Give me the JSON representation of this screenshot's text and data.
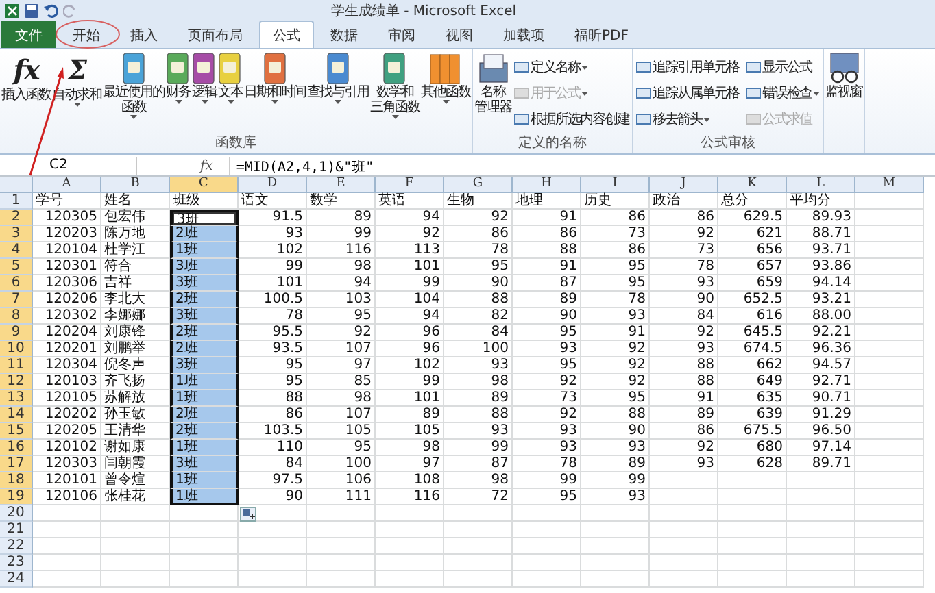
{
  "window": {
    "title": "学生成绩单 - Microsoft Excel"
  },
  "tabs": [
    {
      "label": "文件",
      "kind": "file",
      "selected": false
    },
    {
      "label": "开始",
      "kind": "tab",
      "selected": false
    },
    {
      "label": "插入",
      "kind": "tab",
      "selected": false
    },
    {
      "label": "页面布局",
      "kind": "tab",
      "selected": false
    },
    {
      "label": "公式",
      "kind": "tab",
      "selected": true
    },
    {
      "label": "数据",
      "kind": "tab",
      "selected": false
    },
    {
      "label": "审阅",
      "kind": "tab",
      "selected": false
    },
    {
      "label": "视图",
      "kind": "tab",
      "selected": false
    },
    {
      "label": "加载项",
      "kind": "tab",
      "selected": false
    },
    {
      "label": "福昕PDF",
      "kind": "tab",
      "selected": false
    }
  ],
  "ribbon": {
    "groups": [
      {
        "label": "函数库",
        "large_buttons": [
          {
            "kind": "glyph",
            "glyph": "fx",
            "lines": [
              "插入函数"
            ],
            "menu": false
          },
          {
            "kind": "glyph",
            "glyph": "Σ",
            "lines": [
              "自动求和"
            ],
            "menu": true
          },
          {
            "kind": "book",
            "color": "#4aa3d8",
            "lines": [
              "最近使用的",
              "函数"
            ],
            "menu": true
          },
          {
            "kind": "book",
            "color": "#5aaa5a",
            "lines": [
              "财务"
            ],
            "menu": true
          },
          {
            "kind": "book",
            "color": "#a64ca6",
            "lines": [
              "逻辑"
            ],
            "menu": true
          },
          {
            "kind": "book",
            "color": "#e8d040",
            "lines": [
              "文本"
            ],
            "menu": true
          },
          {
            "kind": "book",
            "color": "#e07040",
            "lines": [
              "日期和时间"
            ],
            "menu": true
          },
          {
            "kind": "book",
            "color": "#4a8ad0",
            "lines": [
              "查找与引用"
            ],
            "menu": true
          },
          {
            "kind": "book",
            "color": "#40a080",
            "lines": [
              "数学和",
              "三角函数"
            ],
            "menu": true
          },
          {
            "kind": "books",
            "color": "#f09030",
            "lines": [
              "其他函数"
            ],
            "menu": true
          }
        ]
      },
      {
        "label": "定义的名称",
        "large_buttons": [
          {
            "kind": "manager",
            "color": "#6a8ab0",
            "lines": [
              "名称",
              "管理器"
            ],
            "menu": false
          }
        ],
        "small_buttons": [
          {
            "label": "定义名称",
            "disabled": false,
            "menu": true
          },
          {
            "label": "用于公式",
            "disabled": true,
            "menu": true
          },
          {
            "label": "根据所选内容创建",
            "disabled": false,
            "menu": false
          }
        ]
      },
      {
        "label": "公式审核",
        "small_buttons": [
          {
            "label": "追踪引用单元格",
            "disabled": false,
            "menu": false
          },
          {
            "label": "显示公式",
            "disabled": false,
            "menu": false
          },
          {
            "label": "追踪从属单元格",
            "disabled": false,
            "menu": false
          },
          {
            "label": "错误检查",
            "disabled": false,
            "menu": true
          },
          {
            "label": "移去箭头",
            "disabled": false,
            "menu": true
          },
          {
            "label": "公式求值",
            "disabled": true,
            "menu": false
          }
        ]
      },
      {
        "large_buttons": [
          {
            "kind": "watch",
            "color": "#7090c0",
            "lines": [
              "监视窗"
            ],
            "menu": false
          }
        ]
      }
    ]
  },
  "formula_bar": {
    "name_box": "C2",
    "fx": "fx",
    "formula": "=MID(A2,4,1)&\"班\""
  },
  "sheet": {
    "columns": [
      {
        "letter": "A",
        "kind": "number",
        "selected": false
      },
      {
        "letter": "B",
        "kind": "text",
        "selected": false
      },
      {
        "letter": "C",
        "kind": "text",
        "selected": true
      },
      {
        "letter": "D",
        "kind": "number",
        "selected": false
      },
      {
        "letter": "E",
        "kind": "number",
        "selected": false
      },
      {
        "letter": "F",
        "kind": "number",
        "selected": false
      },
      {
        "letter": "G",
        "kind": "number",
        "selected": false
      },
      {
        "letter": "H",
        "kind": "number",
        "selected": false
      },
      {
        "letter": "I",
        "kind": "number",
        "selected": false
      },
      {
        "letter": "J",
        "kind": "number",
        "selected": false
      },
      {
        "letter": "K",
        "kind": "number",
        "selected": false
      },
      {
        "letter": "L",
        "kind": "number",
        "selected": false
      },
      {
        "letter": "M",
        "kind": "number",
        "selected": false
      }
    ],
    "rows": [
      {
        "number": "1",
        "kind": "header",
        "selected": false,
        "active": false,
        "cells": [
          "学号",
          "姓名",
          "班级",
          "语文",
          "数学",
          "英语",
          "生物",
          "地理",
          "历史",
          "政治",
          "总分",
          "平均分"
        ]
      },
      {
        "number": "2",
        "kind": "data",
        "selected": true,
        "active": true,
        "cells": [
          "120305",
          "包宏伟",
          "3班",
          "91.5",
          "89",
          "94",
          "92",
          "91",
          "86",
          "86",
          "629.5",
          "89.93"
        ]
      },
      {
        "number": "3",
        "kind": "data",
        "selected": true,
        "active": false,
        "cells": [
          "120203",
          "陈万地",
          "2班",
          "93",
          "99",
          "92",
          "86",
          "86",
          "73",
          "92",
          "621",
          "88.71"
        ]
      },
      {
        "number": "4",
        "kind": "data",
        "selected": true,
        "active": false,
        "cells": [
          "120104",
          "杜学江",
          "1班",
          "102",
          "116",
          "113",
          "78",
          "88",
          "86",
          "73",
          "656",
          "93.71"
        ]
      },
      {
        "number": "5",
        "kind": "data",
        "selected": true,
        "active": false,
        "cells": [
          "120301",
          "符合",
          "3班",
          "99",
          "98",
          "101",
          "95",
          "91",
          "95",
          "78",
          "657",
          "93.86"
        ]
      },
      {
        "number": "6",
        "kind": "data",
        "selected": true,
        "active": false,
        "cells": [
          "120306",
          "吉祥",
          "3班",
          "101",
          "94",
          "99",
          "90",
          "87",
          "95",
          "93",
          "659",
          "94.14"
        ]
      },
      {
        "number": "7",
        "kind": "data",
        "selected": true,
        "active": false,
        "cells": [
          "120206",
          "李北大",
          "2班",
          "100.5",
          "103",
          "104",
          "88",
          "89",
          "78",
          "90",
          "652.5",
          "93.21"
        ]
      },
      {
        "number": "8",
        "kind": "data",
        "selected": true,
        "active": false,
        "cells": [
          "120302",
          "李娜娜",
          "3班",
          "78",
          "95",
          "94",
          "82",
          "90",
          "93",
          "84",
          "616",
          "88.00"
        ]
      },
      {
        "number": "9",
        "kind": "data",
        "selected": true,
        "active": false,
        "cells": [
          "120204",
          "刘康锋",
          "2班",
          "95.5",
          "92",
          "96",
          "84",
          "95",
          "91",
          "92",
          "645.5",
          "92.21"
        ]
      },
      {
        "number": "10",
        "kind": "data",
        "selected": true,
        "active": false,
        "cells": [
          "120201",
          "刘鹏举",
          "2班",
          "93.5",
          "107",
          "96",
          "100",
          "93",
          "92",
          "93",
          "674.5",
          "96.36"
        ]
      },
      {
        "number": "11",
        "kind": "data",
        "selected": true,
        "active": false,
        "cells": [
          "120304",
          "倪冬声",
          "3班",
          "95",
          "97",
          "102",
          "93",
          "95",
          "92",
          "88",
          "662",
          "94.57"
        ]
      },
      {
        "number": "12",
        "kind": "data",
        "selected": true,
        "active": false,
        "cells": [
          "120103",
          "齐飞扬",
          "1班",
          "95",
          "85",
          "99",
          "98",
          "92",
          "92",
          "88",
          "649",
          "92.71"
        ]
      },
      {
        "number": "13",
        "kind": "data",
        "selected": true,
        "active": false,
        "cells": [
          "120105",
          "苏解放",
          "1班",
          "88",
          "98",
          "101",
          "89",
          "73",
          "95",
          "91",
          "635",
          "90.71"
        ]
      },
      {
        "number": "14",
        "kind": "data",
        "selected": true,
        "active": false,
        "cells": [
          "120202",
          "孙玉敏",
          "2班",
          "86",
          "107",
          "89",
          "88",
          "92",
          "88",
          "89",
          "639",
          "91.29"
        ]
      },
      {
        "number": "15",
        "kind": "data",
        "selected": true,
        "active": false,
        "cells": [
          "120205",
          "王清华",
          "2班",
          "103.5",
          "105",
          "105",
          "93",
          "93",
          "90",
          "86",
          "675.5",
          "96.50"
        ]
      },
      {
        "number": "16",
        "kind": "data",
        "selected": true,
        "active": false,
        "cells": [
          "120102",
          "谢如康",
          "1班",
          "110",
          "95",
          "98",
          "99",
          "93",
          "93",
          "92",
          "680",
          "97.14"
        ]
      },
      {
        "number": "17",
        "kind": "data",
        "selected": true,
        "active": false,
        "cells": [
          "120303",
          "闫朝霞",
          "3班",
          "84",
          "100",
          "97",
          "87",
          "78",
          "89",
          "93",
          "628",
          "89.71"
        ]
      },
      {
        "number": "18",
        "kind": "data",
        "selected": true,
        "active": false,
        "cells": [
          "120101",
          "曾令煊",
          "1班",
          "97.5",
          "106",
          "108",
          "98",
          "99",
          "99"
        ]
      },
      {
        "number": "19",
        "kind": "data",
        "selected": true,
        "active": false,
        "cells": [
          "120106",
          "张桂花",
          "1班",
          "90",
          "111",
          "116",
          "72",
          "95",
          "93"
        ]
      },
      {
        "number": "20",
        "kind": "data",
        "selected": false,
        "active": false,
        "cells": []
      },
      {
        "number": "21",
        "kind": "data",
        "selected": false,
        "active": false,
        "cells": []
      },
      {
        "number": "22",
        "kind": "data",
        "selected": false,
        "active": false,
        "cells": []
      },
      {
        "number": "23",
        "kind": "data",
        "selected": false,
        "active": false,
        "cells": []
      },
      {
        "number": "24",
        "kind": "data",
        "selected": false,
        "active": false,
        "cells": []
      }
    ]
  }
}
